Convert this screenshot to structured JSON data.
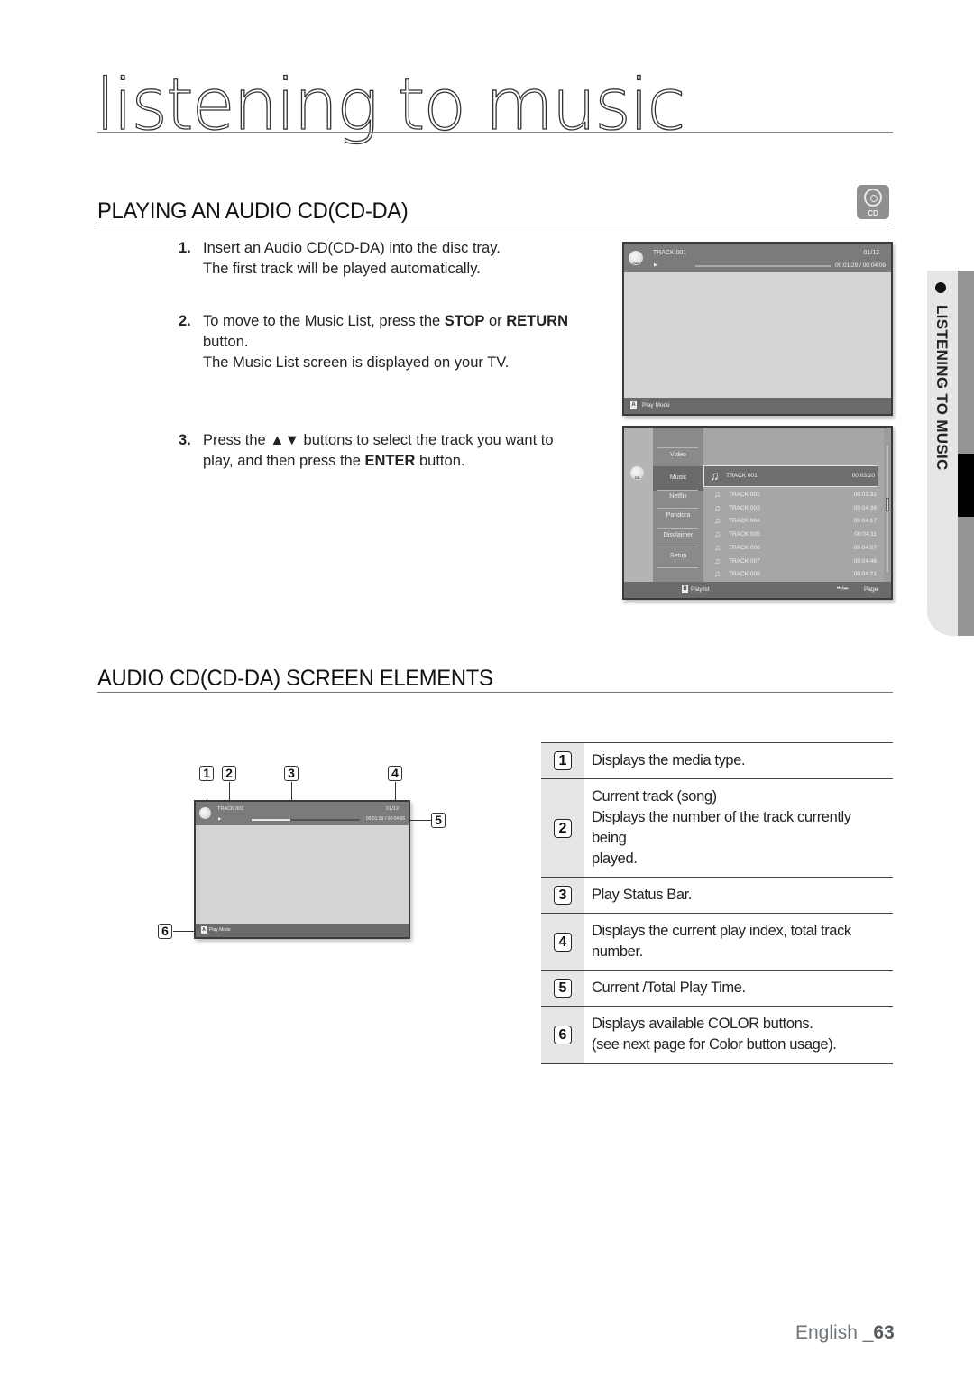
{
  "page": {
    "title": "listening to music",
    "side_tab": "LISTENING TO MUSIC",
    "footer": {
      "language": "English _",
      "page_number": "63"
    }
  },
  "section1": {
    "heading": "PLAYING AN AUDIO CD(CD-DA)",
    "badge_label": "CD",
    "badge_icon": "cd-disc-icon",
    "steps": [
      {
        "num": "1.",
        "lines": [
          "Insert an Audio CD(CD-DA) into the disc tray.",
          "The first track will be played automatically."
        ]
      },
      {
        "num": "2.",
        "line1_pre": "To move to the Music List, press the ",
        "line1_b1": "STOP",
        "line1_mid": " or ",
        "line1_b2": "RETURN",
        "line2": "button.",
        "line3": "The Music List screen is displayed on your TV."
      },
      {
        "num": "3.",
        "line1": "Press the ▲▼ buttons to select the track you want to",
        "line2_pre": "play, and then press the ",
        "line2_b": "ENTER",
        "line2_post": " button."
      }
    ]
  },
  "playback_screen": {
    "track": "TRACK 001",
    "index": "01/12",
    "play_icon": "▶",
    "time": "00:01:29 / 00:04:06",
    "progress_fraction": 0.36,
    "color_button": "A",
    "color_button_label": "Play Mode",
    "disc_label": "CD"
  },
  "music_list_screen": {
    "disc_label": "CD",
    "menu": [
      "Video",
      "Music",
      "Netflix",
      "Pandora",
      "Disclaimer",
      "Setup"
    ],
    "selected_menu": "Music",
    "tracks": [
      {
        "name": "TRACK 001",
        "time": "00:03:20"
      },
      {
        "name": "TRACK 002",
        "time": "00:03:32"
      },
      {
        "name": "TRACK 003",
        "time": "00:04:36"
      },
      {
        "name": "TRACK 004",
        "time": "00:04:17"
      },
      {
        "name": "TRACK 005",
        "time": "00:04:11"
      },
      {
        "name": "TRACK 006",
        "time": "00:04:07"
      },
      {
        "name": "TRACK 007",
        "time": "00:04:46"
      },
      {
        "name": "TRACK 008",
        "time": "00:04:21"
      }
    ],
    "color_button": "B",
    "color_button_label": "Playlist",
    "page_hint_icon": "⏮/⏭",
    "page_hint": "Page"
  },
  "section2": {
    "heading": "AUDIO CD(CD-DA) SCREEN ELEMENTS",
    "diagram": {
      "callouts": [
        "1",
        "2",
        "3",
        "4",
        "5",
        "6"
      ],
      "track": "TRACK 001",
      "index": "01/12",
      "time": "00:01:29 / 00:04:06",
      "color_button": "A",
      "color_button_label": "Play Mode"
    },
    "elements": [
      {
        "num": "1",
        "lines": [
          "Displays the media type."
        ]
      },
      {
        "num": "2",
        "lines": [
          "Current track (song)",
          "Displays the number of the track currently being",
          "played."
        ]
      },
      {
        "num": "3",
        "lines": [
          "Play Status Bar."
        ]
      },
      {
        "num": "4",
        "lines": [
          "Displays the current play index, total track number."
        ]
      },
      {
        "num": "5",
        "lines": [
          "Current /Total Play Time."
        ]
      },
      {
        "num": "6",
        "lines": [
          "Displays available COLOR buttons.",
          "(see next page for Color button usage)."
        ]
      }
    ]
  }
}
